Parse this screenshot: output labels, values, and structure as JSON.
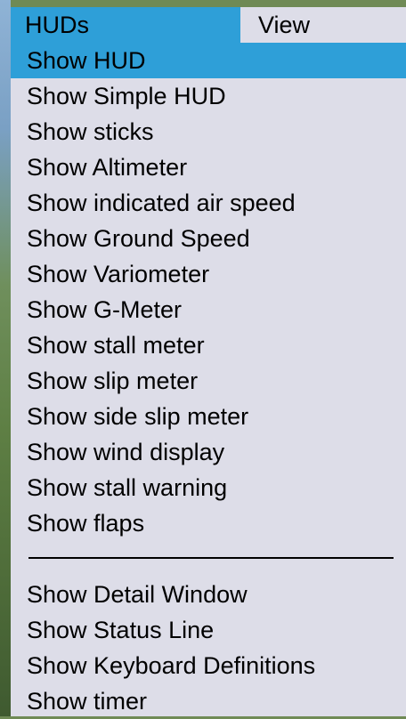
{
  "menubar": {
    "items": [
      {
        "label": "HUDs",
        "active": true
      },
      {
        "label": "View",
        "active": false
      }
    ]
  },
  "menu": {
    "highlight_color": "#2e9fd8",
    "background_color": "#dddde8",
    "group1": [
      {
        "label": "Show HUD",
        "highlighted": true
      },
      {
        "label": "Show Simple HUD"
      },
      {
        "label": "Show sticks"
      },
      {
        "label": "Show Altimeter"
      },
      {
        "label": "Show indicated air speed"
      },
      {
        "label": "Show Ground Speed"
      },
      {
        "label": "Show Variometer"
      },
      {
        "label": "Show G-Meter"
      },
      {
        "label": "Show stall meter"
      },
      {
        "label": "Show slip meter"
      },
      {
        "label": "Show side slip meter"
      },
      {
        "label": "Show wind display"
      },
      {
        "label": "Show stall warning"
      },
      {
        "label": "Show flaps"
      }
    ],
    "group2": [
      {
        "label": "Show Detail Window"
      },
      {
        "label": "Show Status Line"
      },
      {
        "label": "Show Keyboard Definitions"
      },
      {
        "label": "Show timer"
      }
    ]
  }
}
